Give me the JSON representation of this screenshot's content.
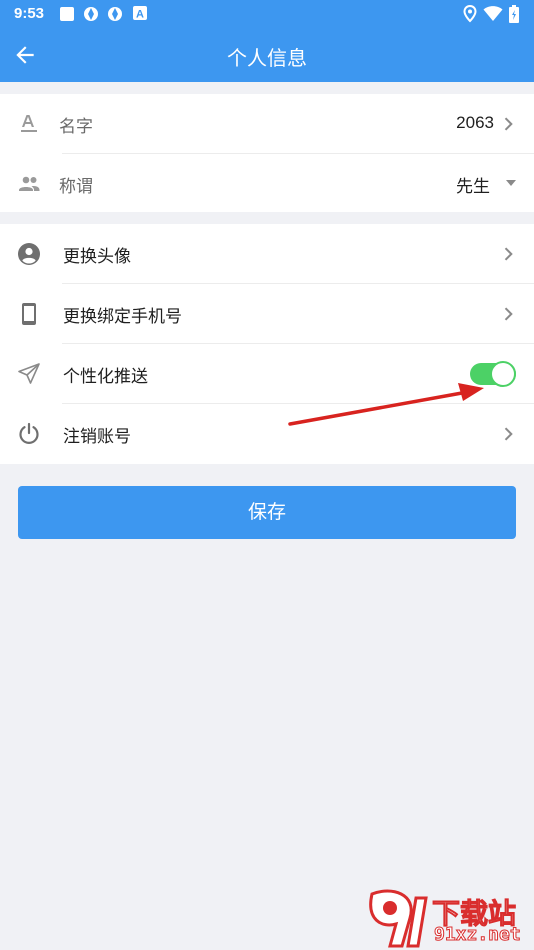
{
  "status_bar": {
    "time": "9:53",
    "left_icons": [
      "square-notification-icon",
      "app-notification-icon",
      "app-notification-icon",
      "a-notification-icon"
    ],
    "right_icons": [
      "location-icon",
      "wifi-icon",
      "battery-icon"
    ]
  },
  "app_bar": {
    "back_icon": "arrow-left-icon",
    "title": "个人信息"
  },
  "profile_section": {
    "rows": [
      {
        "icon": "font-a-icon",
        "label": "名字",
        "value": "2063",
        "control": "chevron-right"
      },
      {
        "icon": "people-icon",
        "label": "称谓",
        "value": "先生",
        "control": "dropdown-triangle"
      }
    ]
  },
  "settings_section": {
    "rows": [
      {
        "icon": "account-circle-icon",
        "label": "更换头像",
        "control": "chevron-right"
      },
      {
        "icon": "phone-icon",
        "label": "更换绑定手机号",
        "control": "chevron-right"
      },
      {
        "icon": "paper-plane-icon",
        "label": "个性化推送",
        "control": "toggle",
        "toggle_on": true
      },
      {
        "icon": "power-icon",
        "label": "注销账号",
        "control": "chevron-right"
      }
    ]
  },
  "save_button": {
    "label": "保存"
  },
  "colors": {
    "primary": "#3d97f0",
    "toggle_on": "#4cd166",
    "background": "#f0f1f5",
    "annotation_arrow": "#d8231f"
  },
  "watermark": {
    "logo_text": "下载站",
    "site": "91xz.net"
  }
}
